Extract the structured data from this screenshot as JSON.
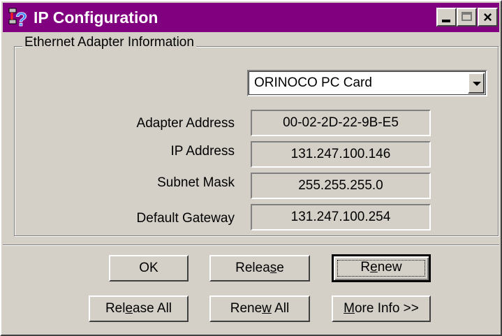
{
  "window": {
    "title": "IP Configuration",
    "controls": [
      "minimize-icon",
      "maximize-icon",
      "close-icon"
    ],
    "title_bar_color": "#800080"
  },
  "group": {
    "label": "Ethernet  Adapter Information"
  },
  "adapter_select": {
    "selected": "ORINOCO PC Card"
  },
  "fields": [
    {
      "label": "Adapter Address",
      "value": "00-02-2D-22-9B-E5"
    },
    {
      "label": "IP Address",
      "value": "131.247.100.146"
    },
    {
      "label": "Subnet Mask",
      "value": "255.255.255.0"
    },
    {
      "label": "Default Gateway",
      "value": "131.247.100.254"
    }
  ],
  "buttons": {
    "ok": {
      "label": "OK"
    },
    "release": {
      "pre": "Relea",
      "ul": "s",
      "post": "e"
    },
    "renew": {
      "pre": "R",
      "ul": "e",
      "post": "new"
    },
    "release_all": {
      "pre": "Rel",
      "ul": "e",
      "post": "ase All"
    },
    "renew_all": {
      "pre": "Rene",
      "ul": "w",
      "post": " All"
    },
    "more_info": {
      "pre": "",
      "ul": "M",
      "post": "ore Info >>"
    }
  }
}
